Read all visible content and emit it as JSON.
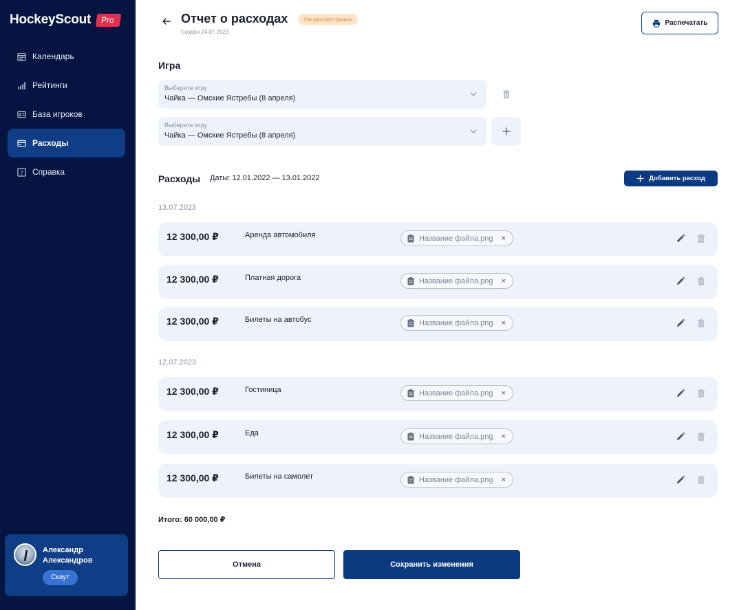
{
  "brand": {
    "name": "HockeyScout",
    "badge": "Pro",
    "badge_color": "#e0304e"
  },
  "sidebar": {
    "items": [
      {
        "label": "Календарь",
        "icon": "calendar-icon",
        "active": false
      },
      {
        "label": "Рейтинги",
        "icon": "bar-chart-icon",
        "active": false
      },
      {
        "label": "База игроков",
        "icon": "id-card-icon",
        "active": false
      },
      {
        "label": "Расходы",
        "icon": "credit-card-icon",
        "active": true
      },
      {
        "label": "Справка",
        "icon": "help-icon",
        "active": false
      }
    ]
  },
  "user": {
    "name": "Александр Александров",
    "role": "Скаут"
  },
  "header": {
    "title": "Отчет о расходах",
    "status": "На рассмотрении",
    "created": "Создан 24.07.2023",
    "print_label": "Распечатать"
  },
  "game": {
    "section_title": "Игра",
    "selects": [
      {
        "label": "Выберите игру",
        "value": "Чайка — Омские Ястребы (8 апреля)"
      },
      {
        "label": "Выберите игру",
        "value": "Чайка — Омские Ястребы (8 апреля)"
      }
    ]
  },
  "expenses": {
    "section_title": "Расходы",
    "dates": "Даты: 12.01.2022 — 13.01.2022",
    "add_label": "Добавить расход",
    "groups": [
      {
        "date": "13.07.2023",
        "items": [
          {
            "amount": "12 300,00 ₽",
            "name": "Аренда автомобиля",
            "file": "Название файла.png"
          },
          {
            "amount": "12 300,00 ₽",
            "name": "Платная дорога",
            "file": "Название файла.png"
          },
          {
            "amount": "12 300,00 ₽",
            "name": "Билеты на автобус",
            "file": "Название файла.png"
          }
        ]
      },
      {
        "date": "12.07.2023",
        "items": [
          {
            "amount": "12 300,00 ₽",
            "name": "Гостиница",
            "file": "Название файла.png"
          },
          {
            "amount": "12 300,00 ₽",
            "name": "Еда",
            "file": "Название файла.png"
          },
          {
            "amount": "12 300,00 ₽",
            "name": "Билеты на самолет",
            "file": "Название файла.png"
          }
        ]
      }
    ],
    "total": "Итого: 60 000,00 ₽"
  },
  "actions": {
    "cancel": "Отмена",
    "save": "Сохранить изменения"
  },
  "colors": {
    "sidebar_bg": "#051440",
    "primary": "#0b3a80",
    "row_bg": "#eef3fb",
    "status_bg": "#fde3c8",
    "status_text": "#e08a3c"
  }
}
